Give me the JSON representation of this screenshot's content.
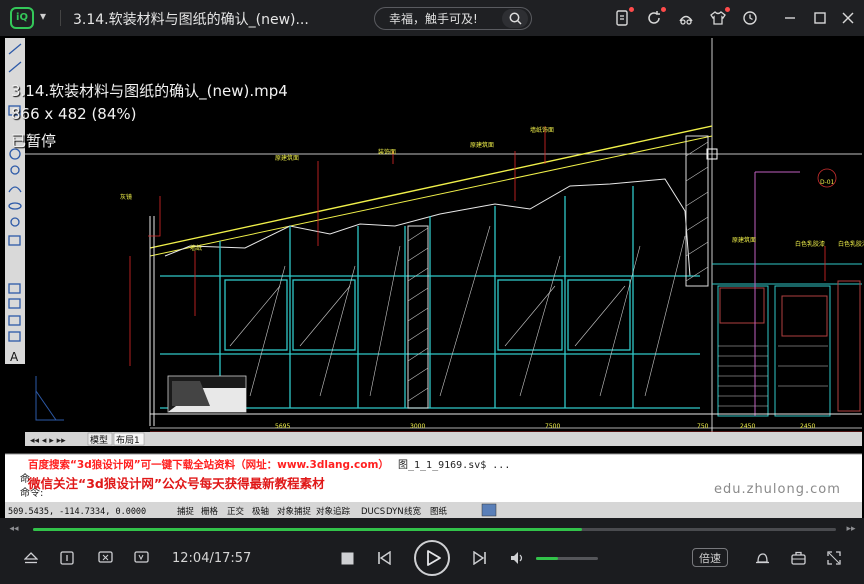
{
  "titlebar": {
    "app_logo_text": "iQ",
    "title": "3.14.软装材料与图纸的确认_(new)...",
    "search_placeholder": "幸福，触手可及!"
  },
  "video": {
    "osd_filename": "3.14.软装材料与图纸的确认_(new).mp4",
    "osd_resolution": "866 x 482 (84%)",
    "osd_state": "已暂停",
    "watermark_site": "edu.zhulong.com",
    "ad_line1": "百度搜索“3d狼设计网”可一键下载全站资料（网址：www.3dlang.com）",
    "ad_line2": "微信关注“3d狼设计网”公众号每天获得最新教程素材",
    "cad": {
      "tabs": [
        "模型",
        "布局1"
      ],
      "command_file": "图_1_1_9169.sv$ ...",
      "command_prefix": "命",
      "command_prompt": "命令:",
      "coords": "509.5435, -114.7334, 0.0000",
      "status_buttons": [
        "捕捉",
        "栅格",
        "正交",
        "极轴",
        "对象捕捉",
        "对象追踪",
        "DUCS",
        "DYN",
        "线宽",
        "图纸"
      ],
      "toolbar_letter": "A",
      "annotations": [
        "灰镜",
        "原建筑面",
        "装饰面",
        "墙纸",
        "原建筑面",
        "墙纸饰面",
        "白色乳胶漆",
        "白色乳胶漆",
        "原建筑面",
        "D-01"
      ],
      "dims": [
        "5695",
        "7500",
        "2450",
        "750",
        "2450",
        "3000"
      ]
    }
  },
  "player": {
    "progress_fraction": 0.684,
    "time": "12:04/17:57",
    "volume_fraction": 0.35,
    "speed_label": "倍速"
  }
}
